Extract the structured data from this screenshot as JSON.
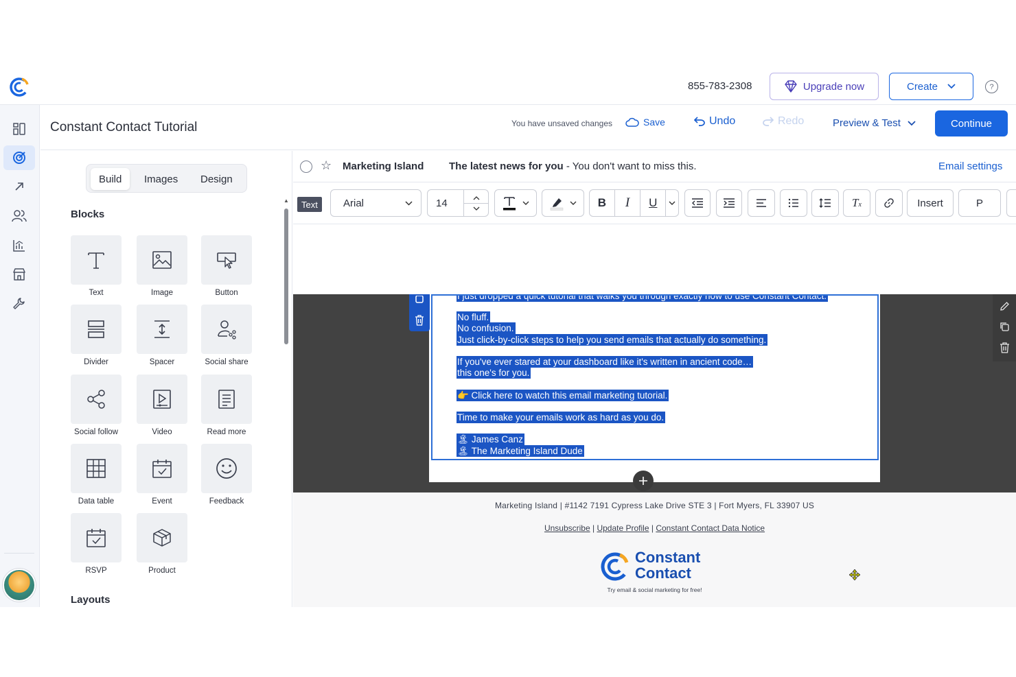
{
  "topbar": {
    "phone": "855-783-2308",
    "upgrade_label": "Upgrade now",
    "create_label": "Create",
    "help_label": "?"
  },
  "titlebar": {
    "title": "Constant Contact Tutorial",
    "unsaved_text": "You have unsaved changes",
    "save_label": "Save",
    "undo_label": "Undo",
    "redo_label": "Redo",
    "preview_label": "Preview & Test",
    "continue_label": "Continue"
  },
  "panel": {
    "tabs": [
      "Build",
      "Images",
      "Design"
    ],
    "active_tab": "Build",
    "blocks_heading": "Blocks",
    "layouts_heading": "Layouts",
    "blocks": [
      {
        "label": "Text",
        "icon": "text-icon"
      },
      {
        "label": "Image",
        "icon": "image-icon"
      },
      {
        "label": "Button",
        "icon": "button-icon"
      },
      {
        "label": "Divider",
        "icon": "divider-icon"
      },
      {
        "label": "Spacer",
        "icon": "spacer-icon"
      },
      {
        "label": "Social share",
        "icon": "social-share-icon"
      },
      {
        "label": "Social follow",
        "icon": "social-follow-icon"
      },
      {
        "label": "Video",
        "icon": "video-icon"
      },
      {
        "label": "Read more",
        "icon": "read-more-icon"
      },
      {
        "label": "Data table",
        "icon": "data-table-icon"
      },
      {
        "label": "Event",
        "icon": "event-icon"
      },
      {
        "label": "Feedback",
        "icon": "feedback-icon"
      },
      {
        "label": "RSVP",
        "icon": "rsvp-icon"
      },
      {
        "label": "Product",
        "icon": "product-icon"
      }
    ]
  },
  "editor": {
    "sender": "Marketing Island",
    "subject_bold": "The latest news for you",
    "subject_rest": " - You don't want to miss this.",
    "email_settings_label": "Email settings",
    "toolbar": {
      "text_tag": "Text",
      "font": "Arial",
      "size": "14",
      "insert_label": "Insert",
      "paragraph_label": "P",
      "bold": "B",
      "italic": "I",
      "underline": "U"
    },
    "body_lines": [
      "I just dropped a quick tutorial that walks you through exactly how to use Constant Contact.",
      "No fluff.",
      "No confusion.",
      "Just click-by-click steps to help you send emails that actually do something.",
      "If you've ever stared at your dashboard like it's written in ancient code…",
      "this one's for you.",
      "👉 Click here to watch this email marketing tutorial.",
      "Time to make your emails work as hard as you do.",
      "🏝 James Canz",
      "🏝 The Marketing Island Dude"
    ],
    "footer": {
      "address": "Marketing Island | #1142 7191 Cypress Lake Drive STE 3 | Fort Myers, FL 33907 US",
      "unsubscribe": "Unsubscribe",
      "update_profile": "Update Profile",
      "data_notice": "Constant Contact Data Notice",
      "separator": "|",
      "logo_line1": "Constant",
      "logo_line2": "Contact",
      "tagline": "Try email & social marketing for free!"
    }
  },
  "colors": {
    "brand_blue": "#1a66e0",
    "selection": "#1b55c4",
    "canvas_dark": "#424242",
    "upgrade_purple": "#4a3fb8",
    "logo_orange": "#f5a623"
  }
}
